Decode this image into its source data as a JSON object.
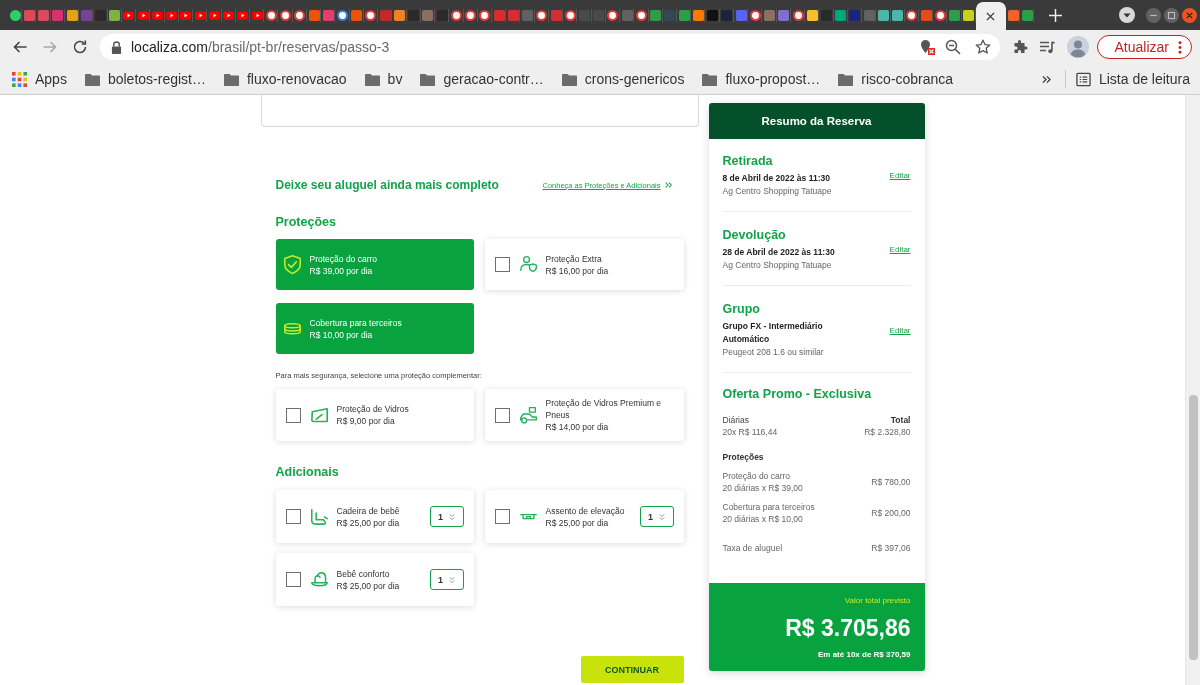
{
  "browser": {
    "tabs": [
      {
        "kind": "dot",
        "color": "#25d366",
        "selected": false
      },
      {
        "kind": "tile",
        "color": "#d94a5a",
        "selected": false
      },
      {
        "kind": "tile",
        "color": "#d94a5a",
        "selected": false
      },
      {
        "kind": "tile",
        "color": "#d6336c",
        "selected": false
      },
      {
        "kind": "tile",
        "color": "#e3a21a",
        "selected": false
      },
      {
        "kind": "tile",
        "color": "#7b3f99",
        "selected": false
      },
      {
        "kind": "tile",
        "color": "#2a2a2a",
        "selected": false
      },
      {
        "kind": "tile",
        "color": "#7cb342",
        "selected": false
      },
      {
        "kind": "play",
        "color": "#ff0000",
        "selected": false
      },
      {
        "kind": "play",
        "color": "#ff0000",
        "selected": false
      },
      {
        "kind": "play",
        "color": "#ff0000",
        "selected": false
      },
      {
        "kind": "play",
        "color": "#ff0000",
        "selected": false
      },
      {
        "kind": "play",
        "color": "#ff0000",
        "selected": false
      },
      {
        "kind": "play",
        "color": "#ff0000",
        "selected": false
      },
      {
        "kind": "play",
        "color": "#ff0000",
        "selected": false
      },
      {
        "kind": "play",
        "color": "#ff0000",
        "selected": false
      },
      {
        "kind": "play",
        "color": "#ff0000",
        "selected": false
      },
      {
        "kind": "play",
        "color": "#ff0000",
        "selected": false
      },
      {
        "kind": "ring",
        "color": "#e53935",
        "selected": false
      },
      {
        "kind": "ring",
        "color": "#e53935",
        "selected": false
      },
      {
        "kind": "ring",
        "color": "#e53935",
        "selected": false
      },
      {
        "kind": "tile",
        "color": "#e8540c",
        "selected": false
      },
      {
        "kind": "tile",
        "color": "#e23d6e",
        "selected": false
      },
      {
        "kind": "ring",
        "color": "#2b7de9",
        "selected": false
      },
      {
        "kind": "tile",
        "color": "#e8540c",
        "selected": false
      },
      {
        "kind": "ring",
        "color": "#e53935",
        "selected": false
      },
      {
        "kind": "tile",
        "color": "#c62828",
        "selected": false
      },
      {
        "kind": "tile",
        "color": "#f48024",
        "selected": false
      },
      {
        "kind": "tile",
        "color": "#2a2a2a",
        "selected": false
      },
      {
        "kind": "tile",
        "color": "#8d6e63",
        "selected": false
      },
      {
        "kind": "tile",
        "color": "#2a2a2a",
        "selected": false
      },
      {
        "kind": "ring",
        "color": "#e53935",
        "selected": false
      },
      {
        "kind": "ring",
        "color": "#e53935",
        "selected": false
      },
      {
        "kind": "ring",
        "color": "#e53935",
        "selected": false
      },
      {
        "kind": "tile",
        "color": "#d32f2f",
        "selected": false
      },
      {
        "kind": "tile",
        "color": "#d32f2f",
        "selected": false
      },
      {
        "kind": "tile",
        "color": "#616161",
        "selected": false
      },
      {
        "kind": "ring",
        "color": "#e53935",
        "selected": false
      },
      {
        "kind": "tile",
        "color": "#d32f2f",
        "selected": false
      },
      {
        "kind": "ring",
        "color": "#e53935",
        "selected": false
      },
      {
        "kind": "tile",
        "color": "#4a4a4a",
        "selected": false
      },
      {
        "kind": "tile",
        "color": "#4a4a4a",
        "selected": false
      },
      {
        "kind": "ring",
        "color": "#e53935",
        "selected": false
      },
      {
        "kind": "tile",
        "color": "#616161",
        "selected": false
      },
      {
        "kind": "ring",
        "color": "#e53935",
        "selected": false
      },
      {
        "kind": "tile",
        "color": "#2e9d47",
        "selected": false
      },
      {
        "kind": "tile",
        "color": "#37474f",
        "selected": false
      },
      {
        "kind": "tile",
        "color": "#2e9d47",
        "selected": false
      },
      {
        "kind": "tile",
        "color": "#f57c00",
        "selected": false
      },
      {
        "kind": "tile",
        "color": "#111111",
        "selected": false
      },
      {
        "kind": "tile",
        "color": "#1c2340",
        "selected": false
      },
      {
        "kind": "tile",
        "color": "#5865f2",
        "selected": false
      },
      {
        "kind": "ring",
        "color": "#e53935",
        "selected": false
      },
      {
        "kind": "tile",
        "color": "#8d6e63",
        "selected": false
      },
      {
        "kind": "tile",
        "color": "#7e6fd0",
        "selected": false
      },
      {
        "kind": "ring",
        "color": "#e53935",
        "selected": false
      },
      {
        "kind": "tile",
        "color": "#f9c02a",
        "selected": false
      },
      {
        "kind": "tile",
        "color": "#2a2a2a",
        "selected": false
      },
      {
        "kind": "tile",
        "color": "#00a67e",
        "selected": false
      },
      {
        "kind": "tile",
        "color": "#1a237e",
        "selected": false
      },
      {
        "kind": "tile",
        "color": "#616161",
        "selected": false
      },
      {
        "kind": "tile",
        "color": "#4db6ac",
        "selected": false
      },
      {
        "kind": "tile",
        "color": "#4db6ac",
        "selected": false
      },
      {
        "kind": "ring",
        "color": "#e53935",
        "selected": false
      },
      {
        "kind": "tile",
        "color": "#e64a19",
        "selected": false
      },
      {
        "kind": "ring",
        "color": "#e53935",
        "selected": false
      },
      {
        "kind": "tile",
        "color": "#2e9d47",
        "selected": false
      },
      {
        "kind": "tile",
        "color": "#c6d21e",
        "selected": false
      },
      {
        "selected": true
      },
      {
        "kind": "tile",
        "color": "#f0642a",
        "selected": false
      },
      {
        "kind": "tile",
        "color": "#2e9d47",
        "selected": false
      }
    ],
    "forward_disabled": true,
    "address": {
      "host": "localiza.com",
      "path": "/brasil/pt-br/reservas/passo-3"
    },
    "update_button": "Atualizar",
    "bookmarks": [
      {
        "kind": "apps",
        "label": "Apps"
      },
      {
        "kind": "folder",
        "label": "boletos-regist…"
      },
      {
        "kind": "folder",
        "label": "fluxo-renovacao"
      },
      {
        "kind": "folder",
        "label": "bv"
      },
      {
        "kind": "folder",
        "label": "geracao-contr…"
      },
      {
        "kind": "folder",
        "label": "crons-genericos"
      },
      {
        "kind": "folder",
        "label": "fluxo-propost…"
      },
      {
        "kind": "folder",
        "label": "risco-cobranca"
      }
    ],
    "reading_list": "Lista de leitura"
  },
  "extras": {
    "title": "Deixe seu aluguel ainda mais completo",
    "link": "Conheça as Proteções e Adicionais"
  },
  "protections": {
    "title": "Proteções",
    "items": [
      {
        "name": "Proteção do carro",
        "price": "R$ 39,00 por dia",
        "selected": true
      },
      {
        "name": "Proteção Extra",
        "price": "R$ 16,00 por dia",
        "selected": false
      },
      {
        "name": "Cobertura para terceiros",
        "price": "R$ 10,00 por dia",
        "selected": true
      }
    ]
  },
  "complementary": {
    "note": "Para mais segurança, selecione uma proteção complementar:",
    "items": [
      {
        "name": "Proteção de Vidros",
        "price": "R$ 9,00 por dia",
        "selected": false
      },
      {
        "name": "Proteção de Vidros Premium e Pneus",
        "price": "R$ 14,00 por dia",
        "selected": false
      }
    ]
  },
  "additionals": {
    "title": "Adicionais",
    "items": [
      {
        "name": "Cadeira de bebê",
        "price": "R$ 25,00 por dia",
        "selected": false,
        "quantity": "1"
      },
      {
        "name": "Assento de elevação",
        "price": "R$ 25,00 por dia",
        "selected": false,
        "quantity": "1"
      },
      {
        "name": "Bebê conforto",
        "price": "R$ 25,00 por dia",
        "selected": false,
        "quantity": "1"
      }
    ]
  },
  "continue_button": "CONTINUAR",
  "summary": {
    "title": "Resumo da Reserva",
    "sections": [
      {
        "heading": "Retirada",
        "detail": "8 de Abril de 2022 às 11:30",
        "note": "Ag Centro Shopping Tatuape",
        "edit": "Editar"
      },
      {
        "heading": "Devolução",
        "detail": "28 de Abril de 2022 às 11:30",
        "note": "Ag Centro Shopping Tatuape",
        "edit": "Editar"
      },
      {
        "heading": "Grupo",
        "detail": "Grupo FX - Intermediário Automático",
        "note": "Peugeot 208 1.6 ou similar",
        "edit": "Editar"
      }
    ],
    "offer": {
      "heading": "Oferta Promo - Exclusiva",
      "daily": {
        "label": "Diárias",
        "detail": "20x R$ 116,44",
        "total_label": "Total",
        "total": "R$ 2.328,80"
      },
      "protections_heading": "Proteções",
      "charges": [
        {
          "name": "Proteção do carro",
          "detail": "20 diárias x R$ 39,00",
          "amount": "R$ 780,00"
        },
        {
          "name": "Cobertura para terceiros",
          "detail": "20 diárias x R$ 10,00",
          "amount": "R$ 200,00"
        }
      ],
      "fee": {
        "name": "Taxa de aluguel",
        "amount": "R$ 397,06"
      }
    },
    "total": {
      "label": "Valor total previsto",
      "amount": "R$ 3.705,86",
      "installments": "Em até 10x de R$ 370,59"
    }
  }
}
